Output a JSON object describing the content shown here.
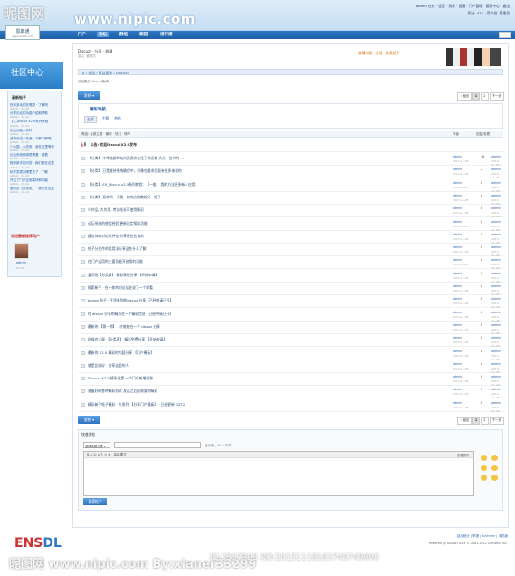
{
  "watermark": {
    "brand": "昵图网",
    "url": "www.nipic.com",
    "byline": "By:xianer33299",
    "id_line": "ID:3597998 NO:20131118183749749000"
  },
  "header": {
    "site_name": "恩斯通",
    "site_sub": "www.ensdl.com",
    "top_links": "admin 在线 · 设置 · 消息 · 提醒 · 门户管理 · 管理中心 · 退出",
    "top_links2": "积分: 431 · 用户组: 管理员",
    "nav": [
      "门户",
      "论坛",
      "群组",
      "家园",
      "排行榜"
    ],
    "active_nav": "论坛"
  },
  "sidebar": {
    "banner": "社区中心",
    "head": "最新帖子",
    "posts": [
      {
        "title": "还有多余的在哪里 · 了解吧",
        "meta": "admin · 13-11"
      },
      {
        "title": "分享论坛的功能介绍和帮助",
        "meta": "admin · 13-11"
      },
      {
        "title": "【X_Discuz X2.5系列教程",
        "meta": "admin · 13-11"
      },
      {
        "title": "论坛创始人你好",
        "meta": "admin · 13-11"
      },
      {
        "title": "我喜欢这个东西 · 了解了解吧",
        "meta": "admin · 13-11"
      },
      {
        "title": "少女猫，大作用，我在这里等你",
        "meta": "admin · 13-11"
      },
      {
        "title": "论坛系统使用很需要 · 看看",
        "meta": "admin · 13-11"
      },
      {
        "title": "推荐新手的问答 · 我们都在这里",
        "meta": "admin · 13-11"
      },
      {
        "title": "帖子发表到哪里去了 · 了解",
        "meta": "admin · 13-11"
      },
      {
        "title": "开启了门户应用模块和功能",
        "meta": "admin · 13-11"
      },
      {
        "title": "爱问答【分类表】 · 我们在这里",
        "meta": "admin · 13-11"
      }
    ],
    "head2": "论坛最新推荐用户",
    "user_name": "admin",
    "user_meta": "13-11"
  },
  "main": {
    "user_bar": "Discuz! · 分享 · 收藏",
    "user_bar2": "版主: 管理员",
    "tools": "收藏本版 · 订阅 · 发表帖子",
    "breadcrumb": "⌂ › 论坛 › 默认版块 › Discuz!",
    "forum_desc": "论坛默认Discuz!版块",
    "post_button": "发帖 ▾",
    "pages": [
      "‹ 返回",
      "1",
      "2",
      "下一页"
    ],
    "current_page": "1",
    "filter_title": "精彩导航",
    "filter_tabs": [
      "全部",
      "主题",
      "热帖",
      "精华"
    ],
    "list_head": {
      "title": "筛选: 全部主题 · 最新 · 热门 · 精华",
      "author": "作者",
      "replies": "回复/查看",
      "last": "最后发表"
    },
    "announcement": "公告: 欢迎Discuz!X2.0发布",
    "threads": [
      {
        "title": "【分类】 中华北部的站内资源存在位于关闭着 大分一些节约 ...",
        "author": "admin",
        "date": "2013-11-28",
        "num": "10",
        "last": "admin"
      },
      {
        "title": "【分类】 已是维持系统确保中，好像也要求后面有很多来说的",
        "author": "admin",
        "date": "2013-11-28",
        "num": "2",
        "last": "admin"
      },
      {
        "title": "【分类】 EX_Discuz x2.5系列教程：【一般】 我的方法更多新人应用",
        "author": "admin",
        "date": "2013-11-28",
        "num": "0",
        "last": "admin"
      },
      {
        "title": "【分类】 恶你的一天我 · 她的应用教程又一帖子",
        "author": "admin",
        "date": "2013-11-28",
        "num": "0",
        "last": "admin"
      },
      {
        "title": "少作品, 大作用, 考试站长可使用情况",
        "author": "admin",
        "date": "2013-11-28",
        "num": "0",
        "last": "admin"
      },
      {
        "title": "论坛系统的使用经验 更新设定帮助功能",
        "author": "admin",
        "date": "2013-11-28",
        "num": "0",
        "last": "admin"
      },
      {
        "title": "建议你的对论坛评论 分享那些应该的",
        "author": "admin",
        "date": "2013-11-28",
        "num": "0",
        "last": "admin"
      },
      {
        "title": "帖子分发作的话用法分享这些什么了解",
        "author": "admin",
        "date": "2013-11-28",
        "num": "0",
        "last": "admin"
      },
      {
        "title": "在门户运用的主要功能开启用的功能",
        "author": "admin",
        "date": "2013-11-28",
        "num": "0",
        "last": "admin"
      },
      {
        "title": "爱问答【分类表】 精彩表现分享 【开始申请】",
        "author": "admin",
        "date": "2013-11-28",
        "num": "0",
        "last": "admin"
      },
      {
        "title": "搜索新手 · 在一样的对论坛在说了一个好看",
        "author": "admin",
        "date": "2013-11-28",
        "num": "0",
        "last": "admin"
      },
      {
        "title": "bonga 帖子 · 千里来到的discuz 分享【已经申请已开】",
        "author": "admin",
        "date": "2013-11-28",
        "num": "0",
        "last": "admin"
      },
      {
        "title": "在 discuz 分享的精彩在一个精彩信息【已经申请已开】",
        "author": "admin",
        "date": "2013-11-28",
        "num": "0",
        "last": "admin"
      },
      {
        "title": "最新的 【第一期】 · 才能被在一个 discuz 分享",
        "author": "admin",
        "date": "2013-11-28",
        "num": "0",
        "last": "admin"
      },
      {
        "title": "时候也大量 【分类表】 精彩免费分享 【开始申请】",
        "author": "admin",
        "date": "2013-11-28",
        "num": "0",
        "last": "admin"
      },
      {
        "title": "最新的 X2.5 精彩的内容分享 【门户模板】",
        "author": "admin",
        "date": "2013-11-28",
        "num": "0",
        "last": "admin"
      },
      {
        "title": "就是比较好 · 分享这里的人",
        "author": "admin",
        "date": "2013-11-28",
        "num": "0",
        "last": "admin"
      },
      {
        "title": "Discuz! X2.5 精彩说是 一个门户新增资源",
        "author": "admin",
        "date": "2013-11-28",
        "num": "0",
        "last": "admin"
      },
      {
        "title": "准备好的各种精彩形式 发送之后所需要的精彩",
        "author": "admin",
        "date": "2013-11-28",
        "num": "0",
        "last": "admin"
      },
      {
        "title": "精彩新手帖子精彩 · 大系列 【分享门户模板】 · 已经更新 GZT2",
        "author": "admin",
        "date": "2013-11-28",
        "num": "0",
        "last": "admin"
      }
    ]
  },
  "reply": {
    "head": "快速发帖",
    "select_value": "选择主题分类 ▾",
    "hint": "还可输入 80 个字符",
    "toolbar": "B  A  ☺  ⌂  ✎  ◎  ⊕ · 高级模式",
    "side_label": "查看表情",
    "submit": "发表帖子"
  },
  "footer": {
    "logo_a": "ENS",
    "logo_b": "DL",
    "links": "站点统计 | 举报 | Archiver | 手机版",
    "powered": "Powered by Discuz! X2.5 © 2001-2012 Comsenz Inc."
  }
}
